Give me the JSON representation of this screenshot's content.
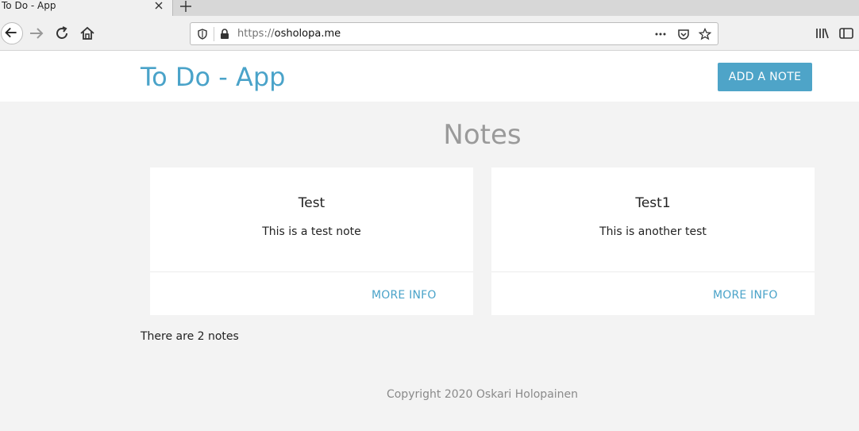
{
  "browser": {
    "tab_title": "To Do - App",
    "url_scheme": "https://",
    "url_host": "osholopa.me"
  },
  "header": {
    "brand": "To Do - App",
    "add_button": "ADD A NOTE"
  },
  "notes_section": {
    "title": "Notes",
    "cards": [
      {
        "title": "Test",
        "text": "This is a test note",
        "link": "MORE INFO"
      },
      {
        "title": "Test1",
        "text": "This is another test",
        "link": "MORE INFO"
      }
    ],
    "count_text": "There are 2 notes"
  },
  "footer": {
    "copyright": "Copyright 2020 Oskari Holopainen"
  },
  "colors": {
    "accent": "#4aa3c9",
    "background": "#f3f3f3",
    "card": "#ffffff"
  }
}
